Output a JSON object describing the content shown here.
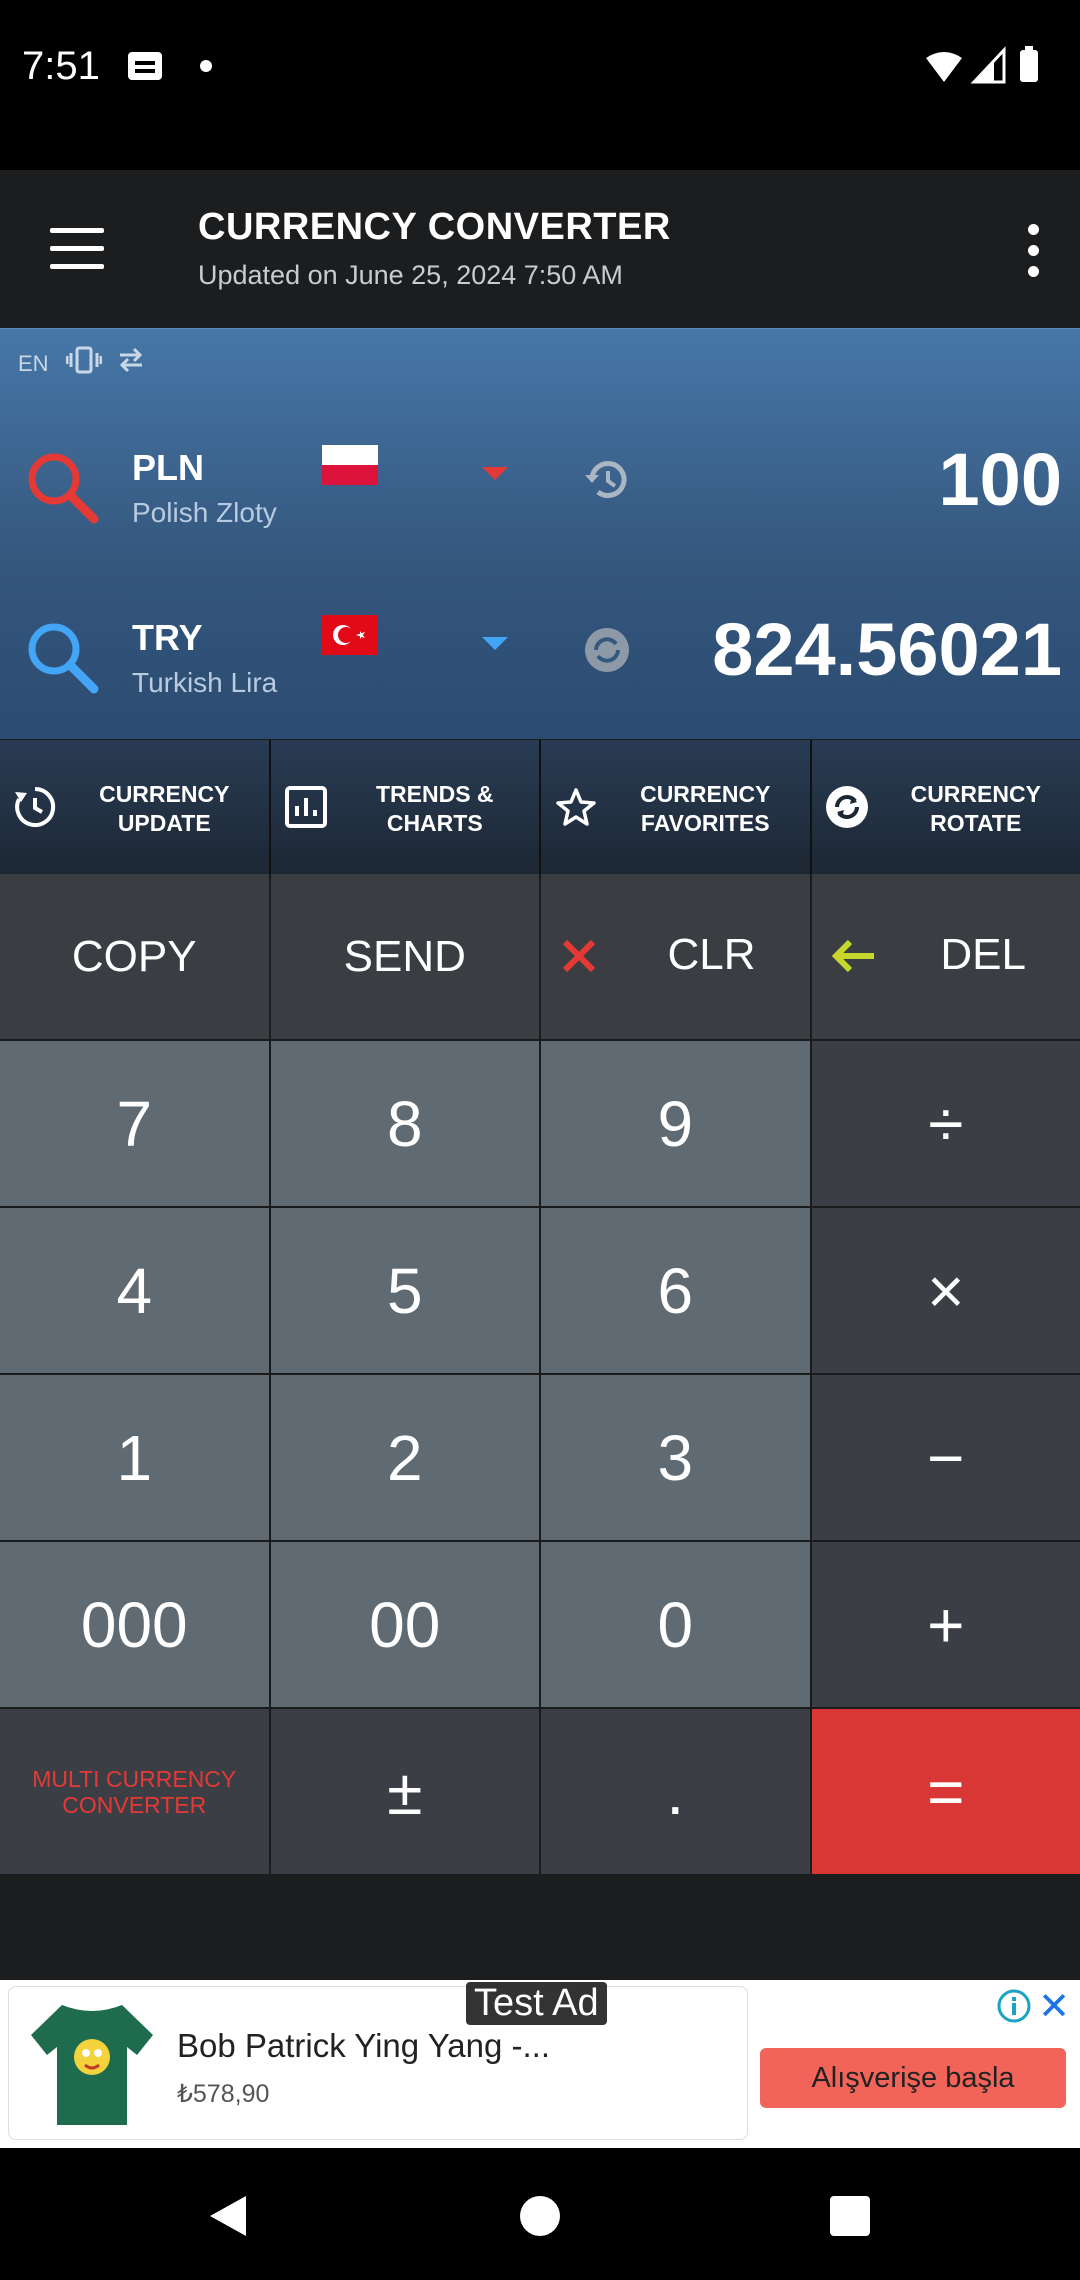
{
  "status": {
    "time": "7:51"
  },
  "appbar": {
    "title": "CURRENCY CONVERTER",
    "subtitle": "Updated on June 25, 2024 7:50 AM"
  },
  "converter": {
    "language": "EN",
    "from": {
      "code": "PLN",
      "name": "Polish Zloty",
      "amount": "100"
    },
    "to": {
      "code": "TRY",
      "name": "Turkish Lira",
      "amount": "824.56021"
    }
  },
  "toolbar": [
    {
      "label": "CURRENCY UPDATE"
    },
    {
      "label": "TRENDS & CHARTS"
    },
    {
      "label": "CURRENCY FAVORITES"
    },
    {
      "label": "CURRENCY ROTATE"
    }
  ],
  "keys": {
    "copy": "COPY",
    "send": "SEND",
    "clr": "CLR",
    "del": "DEL",
    "k7": "7",
    "k8": "8",
    "k9": "9",
    "div": "÷",
    "k4": "4",
    "k5": "5",
    "k6": "6",
    "mul": "×",
    "k1": "1",
    "k2": "2",
    "k3": "3",
    "sub": "−",
    "k000": "000",
    "k00": "00",
    "k0": "0",
    "add": "+",
    "multi": "MULTI CURRENCY CONVERTER",
    "sign": "±",
    "dot": ".",
    "eq": "="
  },
  "ad": {
    "tag": "Test Ad",
    "title": "Bob Patrick Ying Yang -...",
    "price": "₺578,90",
    "button": "Alışverişe başla"
  },
  "colors": {
    "accent_red": "#e53935",
    "search_blue": "#42a5f5",
    "del_arrow": "#c6d62a",
    "equals": "#d93636"
  }
}
